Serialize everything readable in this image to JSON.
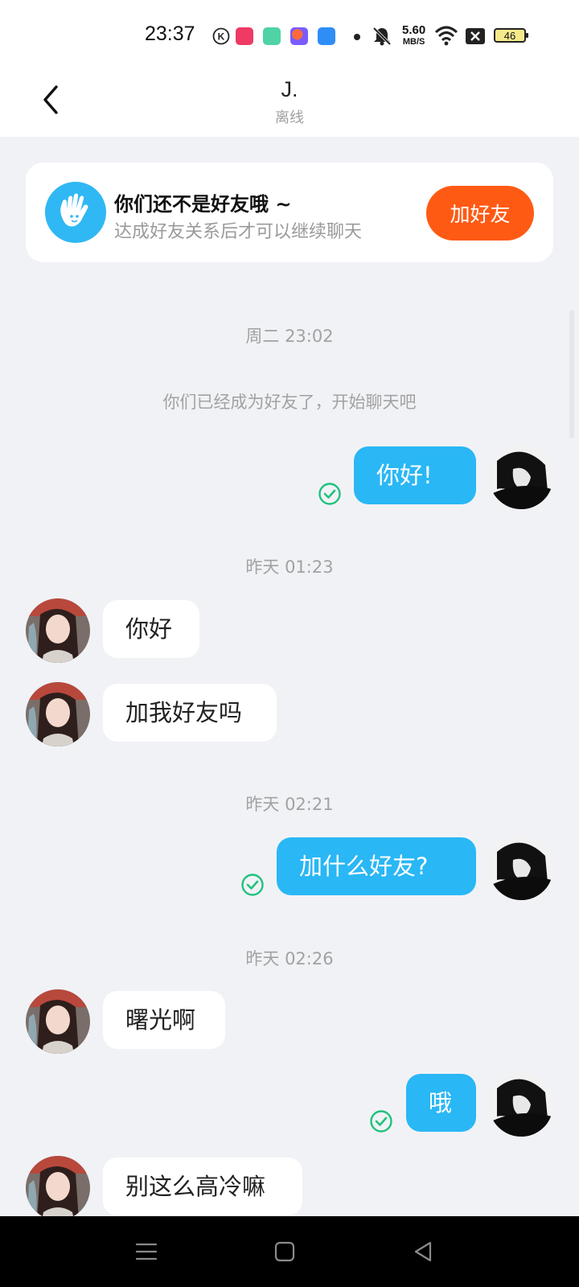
{
  "status_bar": {
    "time": "23:37",
    "net_speed_value": "5.60",
    "net_speed_unit": "MB/S",
    "battery": "46"
  },
  "header": {
    "title": "J.",
    "status": "离线",
    "back_icon": "chevron-left-icon"
  },
  "friend_card": {
    "icon": "waving-hand-icon",
    "title": "你们还不是好友哦 ~",
    "subtitle": "达成好友关系后才可以继续聊天",
    "button_label": "加好友",
    "accent": "#ff5a14"
  },
  "chat": {
    "time_1": "周二 23:02",
    "system_message": "你们已经成为好友了，开始聊天吧",
    "msg_1": "你好!",
    "time_2": "昨天 01:23",
    "msg_2": "你好",
    "msg_3": "加我好友吗",
    "time_3": "昨天 02:21",
    "msg_4": "加什么好友?",
    "time_4": "昨天 02:26",
    "msg_5": "曙光啊",
    "msg_6": "哦",
    "msg_7": "别这么高冷嘛"
  },
  "colors": {
    "my_bubble": "#2ab7f5",
    "their_bubble": "#ffffff",
    "read_check": "#1fc27c",
    "background": "#f1f2f6"
  }
}
